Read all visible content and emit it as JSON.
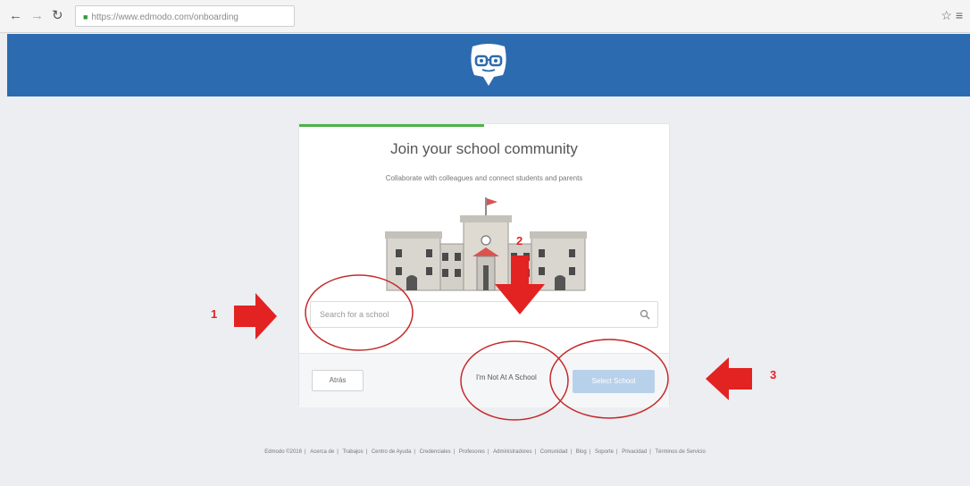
{
  "browser": {
    "url": "https://www.edmodo.com/onboarding"
  },
  "card": {
    "title": "Join your school community",
    "subtitle": "Collaborate with colleagues and connect students and parents",
    "search_placeholder": "Search for a school",
    "progress_fraction": 0.5,
    "back_label": "Atrás",
    "not_school_label": "I'm Not At A School",
    "select_label": "Select School"
  },
  "annotations": {
    "step1": "1",
    "step2": "2",
    "step3": "3",
    "color": "#e32222"
  },
  "footer": {
    "items": [
      "Edmodo ©2016",
      "Acerca de",
      "Trabajos",
      "Centro de Ayuda",
      "Credenciales",
      "Profesores",
      "Administradores",
      "Comunidad",
      "Blog",
      "Soporte",
      "Privacidad",
      "Términos de Servicio"
    ]
  },
  "colors": {
    "header": "#2c6baf",
    "progress": "#4db24a",
    "select_button": "#b8d1ea"
  },
  "icons": [
    "back-arrow-icon",
    "forward-arrow-icon",
    "reload-icon",
    "lock-icon",
    "star-icon",
    "menu-icon",
    "edmodo-logo",
    "search-icon"
  ]
}
